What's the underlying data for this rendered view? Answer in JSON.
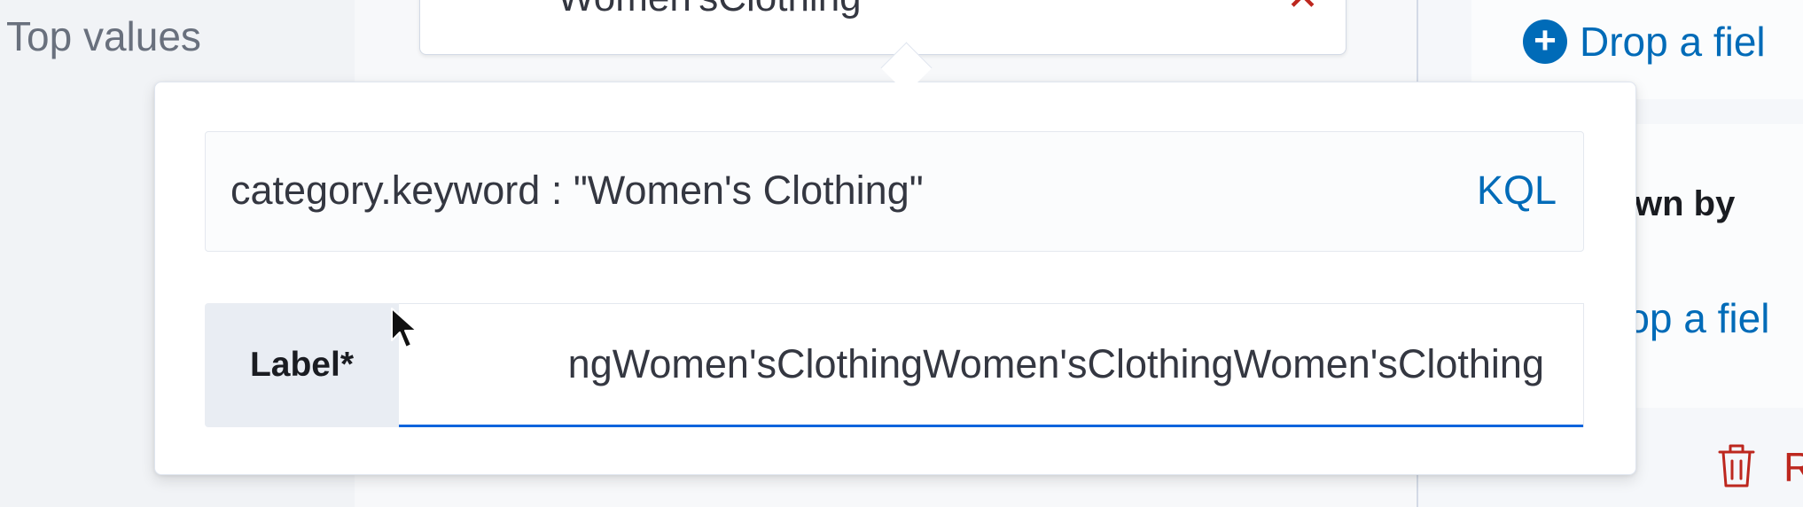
{
  "left_panel": {
    "top_values_label": "Top values"
  },
  "filter_pill": {
    "text": "Women'sClothing"
  },
  "popover": {
    "query": {
      "value": "category.keyword : \"Women's Clothing\"",
      "language_button": "KQL"
    },
    "label_field": {
      "prepend_label": "Label*",
      "value": "ngWomen'sClothingWomen'sClothingWomen'sClothing"
    }
  },
  "right_panel": {
    "drop_field_1": "Drop a fiel",
    "breakdown_label": "wn by",
    "drop_field_2": "rop a fiel",
    "remove_text": "R"
  },
  "colors": {
    "link": "#006bb8",
    "danger": "#bd271e",
    "focus_underline": "#0b64dd"
  }
}
